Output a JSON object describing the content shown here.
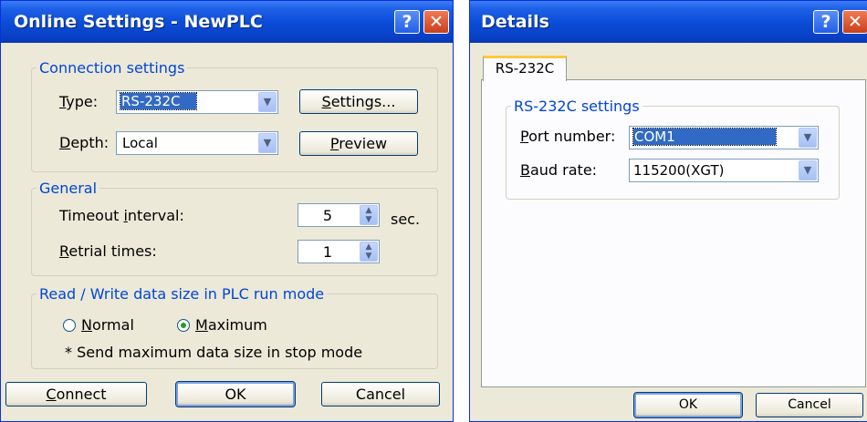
{
  "left_dialog": {
    "title": "Online Settings - NewPLC",
    "help_glyph": "?",
    "close_glyph": "✕",
    "connection": {
      "legend": "Connection settings",
      "type_label": "Type:",
      "type_value": "RS-232C",
      "settings_button": "Settings...",
      "depth_label": "Depth:",
      "depth_value": "Local",
      "preview_button": "Preview"
    },
    "general": {
      "legend": "General",
      "timeout_label": "Timeout interval:",
      "timeout_value": "5",
      "timeout_unit": "sec.",
      "retrial_label": "Retrial times:",
      "retrial_value": "1"
    },
    "rw": {
      "legend": "Read / Write data size in PLC run mode",
      "normal_label": "Normal",
      "maximum_label": "Maximum",
      "selected": "Maximum",
      "note": "* Send maximum data size in stop mode"
    },
    "buttons": {
      "connect": "Connect",
      "ok": "OK",
      "cancel": "Cancel"
    }
  },
  "right_dialog": {
    "title": "Details",
    "help_glyph": "?",
    "close_glyph": "✕",
    "tab_label": "RS-232C",
    "group_legend": "RS-232C settings",
    "port_label": "Port number:",
    "port_value": "COM1",
    "baud_label": "Baud rate:",
    "baud_value": "115200(XGT)",
    "buttons": {
      "ok": "OK",
      "cancel": "Cancel"
    }
  },
  "dropdown_arrow": "▼",
  "spin_up": "▲",
  "spin_down": "▼"
}
